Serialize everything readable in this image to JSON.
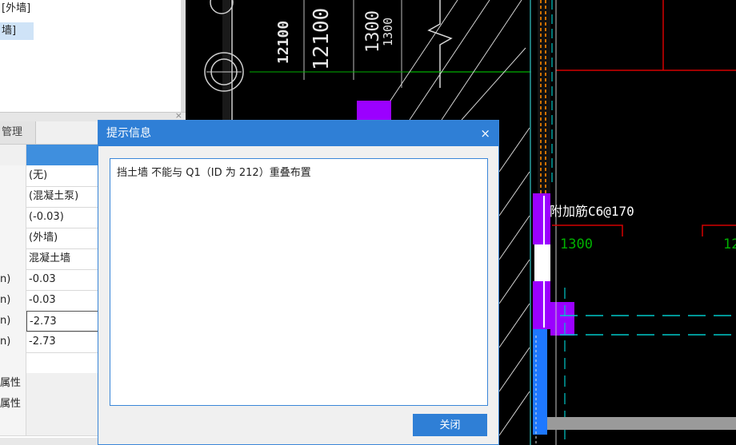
{
  "tree": {
    "item1": "[外墙]",
    "item2": "墙]"
  },
  "tabs": {
    "manage": "管理"
  },
  "properties": {
    "header": "属性",
    "rows": [
      {
        "label": "",
        "value": "(无)"
      },
      {
        "label": "",
        "value": "(混凝土泵)"
      },
      {
        "label": "",
        "value": "(-0.03)"
      },
      {
        "label": "",
        "value": "(外墙)"
      },
      {
        "label": "",
        "value": "混凝土墙"
      },
      {
        "label": "n)",
        "value": "-0.03"
      },
      {
        "label": "n)",
        "value": "-0.03"
      },
      {
        "label": "n)",
        "value": "-2.73"
      },
      {
        "label": "n)",
        "value": "-2.73"
      },
      {
        "label": "",
        "value": ""
      },
      {
        "label": "属性",
        "value": ""
      },
      {
        "label": "属性",
        "value": ""
      },
      {
        "label": "",
        "value": ""
      }
    ]
  },
  "cad": {
    "dims": [
      "12100",
      "12100",
      "1300",
      "1300",
      "1300",
      "12"
    ],
    "rebar_note": "附加筋C6@170"
  },
  "dialog": {
    "title": "提示信息",
    "close_icon": "×",
    "message": "挡土墙 不能与 Q1（ID 为 212）重叠布置",
    "ok_label": "关闭"
  },
  "colors": {
    "accent": "#2f7fd6",
    "cad_bg": "#000000",
    "wall_purple": "#9b00ff",
    "wall_blue": "#1e78ff",
    "axis_red": "#d40000",
    "axis_cyan": "#00c8c8",
    "dim_green": "#00b000"
  }
}
